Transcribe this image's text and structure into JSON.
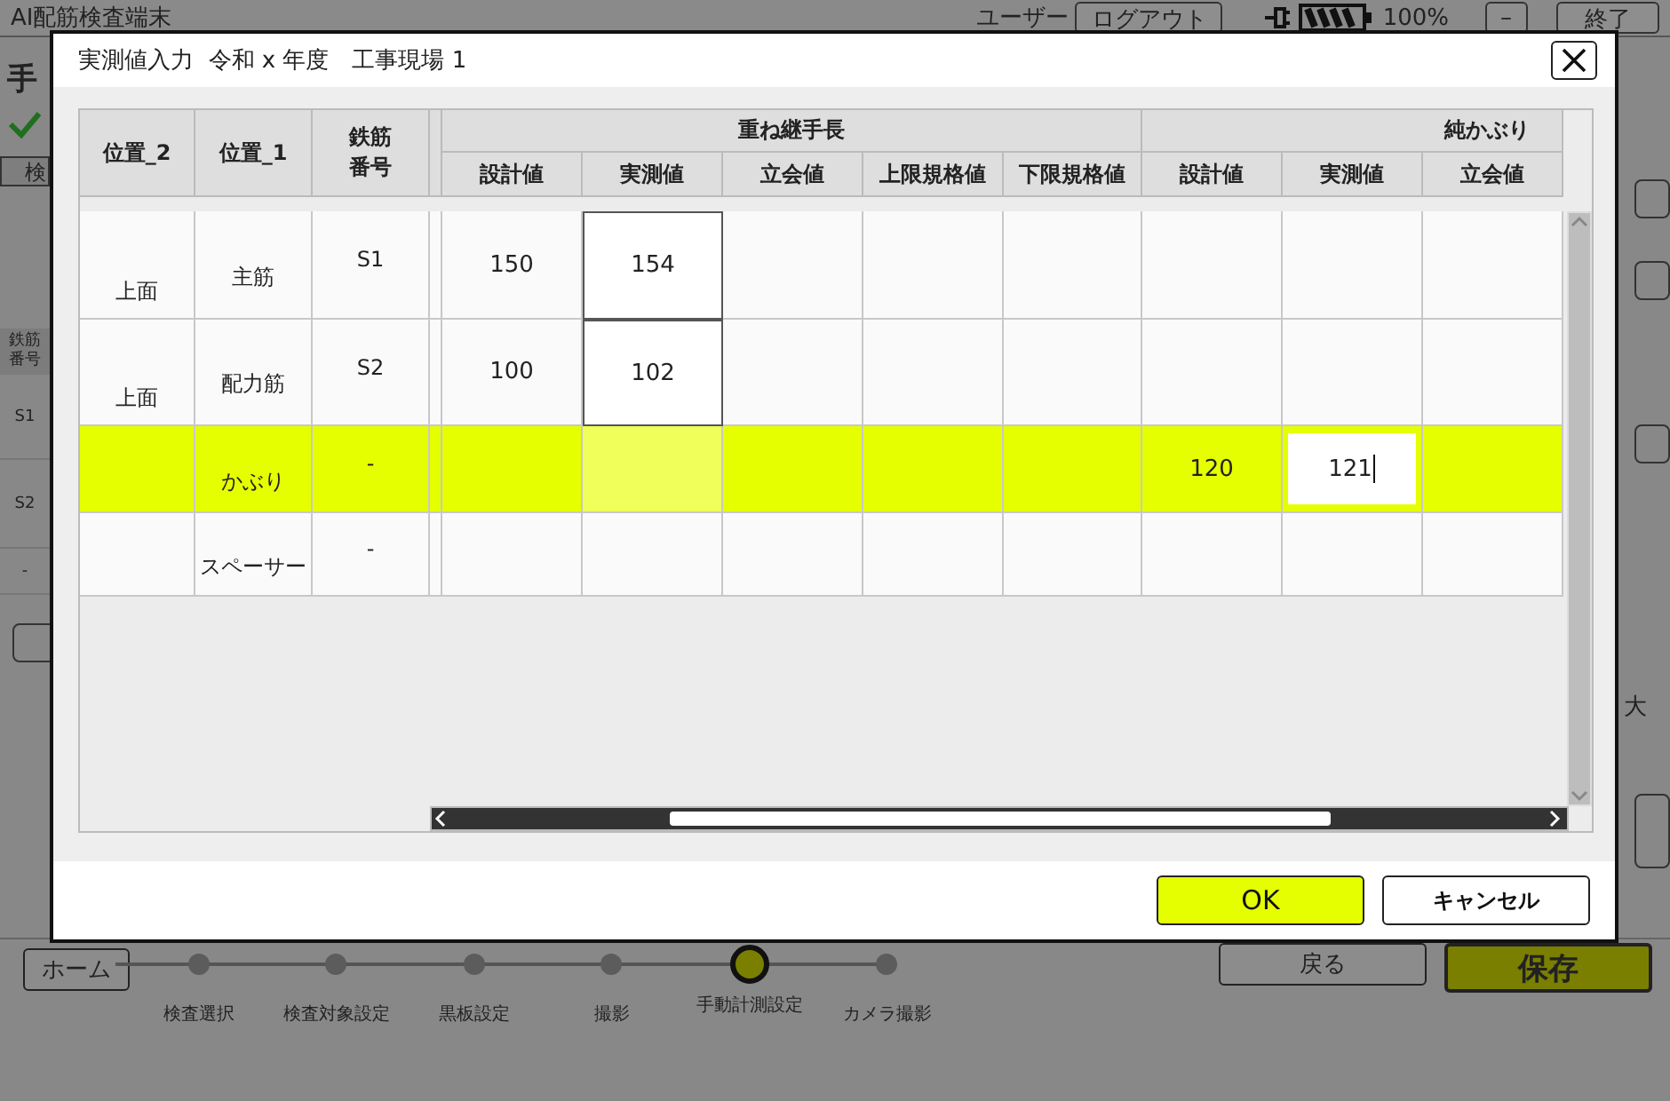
{
  "app": {
    "title": "AI配筋検査端末",
    "user_label": "ユーザー",
    "logout": "ログアウト",
    "battery_text": "100%",
    "minimize": "–",
    "exit": "終了",
    "heading": "手",
    "tab": "検",
    "side_header": "鉄筋番号",
    "side_rows": [
      "S1",
      "S2",
      "-"
    ],
    "side_note": "大"
  },
  "footer": {
    "home": "ホーム",
    "back": "戻る",
    "save": "保存",
    "steps": [
      {
        "label": "検査選択",
        "selected": false
      },
      {
        "label": "検査対象設定",
        "selected": false
      },
      {
        "label": "黒板設定",
        "selected": false
      },
      {
        "label": "撮影",
        "selected": false
      },
      {
        "label": "手動計測設定",
        "selected": true
      },
      {
        "label": "カメラ撮影",
        "selected": false
      }
    ]
  },
  "dialog": {
    "title": "実測値入力  令和 x 年度　工事現場 1",
    "fixed_columns": [
      "位置_2",
      "位置_1",
      "鉄筋番号"
    ],
    "groups": [
      {
        "label": "重ね継手長"
      },
      {
        "label": "純かぶり"
      }
    ],
    "columns": [
      "設計値",
      "実測値",
      "立会値",
      "上限規格値",
      "下限規格値",
      "設計値",
      "実測値",
      "立会値"
    ],
    "rows": [
      {
        "selected": false,
        "fixed": {
          "position_2": "上面",
          "position_1": "主筋",
          "rebar_no": "S1"
        },
        "cells": [
          {
            "kind": "plain",
            "text": "150"
          },
          {
            "kind": "boxed",
            "text": "154"
          },
          {
            "kind": "plain"
          },
          {
            "kind": "plain"
          },
          {
            "kind": "plain"
          },
          {
            "kind": "plain"
          },
          {
            "kind": "plain"
          },
          {
            "kind": "plain"
          }
        ]
      },
      {
        "selected": false,
        "fixed": {
          "position_2": "上面",
          "position_1": "配力筋",
          "rebar_no": "S2"
        },
        "cells": [
          {
            "kind": "plain",
            "text": "100"
          },
          {
            "kind": "boxed",
            "text": "102"
          },
          {
            "kind": "plain"
          },
          {
            "kind": "plain"
          },
          {
            "kind": "plain"
          },
          {
            "kind": "plain"
          },
          {
            "kind": "plain"
          },
          {
            "kind": "plain"
          }
        ]
      },
      {
        "selected": true,
        "fixed": {
          "position_1": "かぶり",
          "rebar_no": "-"
        },
        "cells": [
          {
            "kind": "plain"
          },
          {
            "kind": "soft"
          },
          {
            "kind": "plain"
          },
          {
            "kind": "plain"
          },
          {
            "kind": "plain"
          },
          {
            "kind": "plain",
            "text": "120"
          },
          {
            "kind": "editing",
            "text": "121"
          },
          {
            "kind": "plain"
          }
        ]
      },
      {
        "selected": false,
        "fixed": {
          "position_1": "スペーサー",
          "rebar_no": "-"
        },
        "cells": [
          {
            "kind": "plain"
          },
          {
            "kind": "plain"
          },
          {
            "kind": "plain"
          },
          {
            "kind": "plain"
          },
          {
            "kind": "plain"
          },
          {
            "kind": "plain"
          },
          {
            "kind": "plain"
          },
          {
            "kind": "plain"
          }
        ]
      }
    ],
    "ok": "OK",
    "cancel": "キャンセル"
  }
}
